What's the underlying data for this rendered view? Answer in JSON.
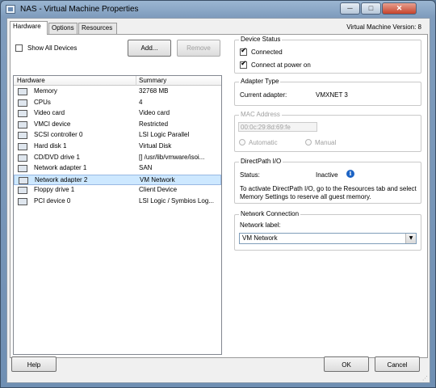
{
  "window": {
    "title": "NAS - Virtual Machine Properties",
    "minimize_glyph": "─",
    "maximize_glyph": "□",
    "close_glyph": "✕"
  },
  "tabs": [
    {
      "label": "Hardware",
      "active": true
    },
    {
      "label": "Options",
      "active": false
    },
    {
      "label": "Resources",
      "active": false
    }
  ],
  "vm_version": "Virtual Machine Version: 8",
  "hardware_toolbar": {
    "show_all_devices_label": "Show All Devices",
    "show_all_devices_checked": false,
    "add_label": "Add...",
    "remove_label": "Remove"
  },
  "hardware_table": {
    "columns": [
      "Hardware",
      "Summary"
    ],
    "rows": [
      {
        "name": "Memory",
        "summary": "32768 MB",
        "icon": "memory-icon"
      },
      {
        "name": "CPUs",
        "summary": "4",
        "icon": "cpu-icon"
      },
      {
        "name": "Video card",
        "summary": "Video card",
        "icon": "video-card-icon"
      },
      {
        "name": "VMCI device",
        "summary": "Restricted",
        "icon": "vmci-device-icon"
      },
      {
        "name": "SCSI controller 0",
        "summary": "LSI Logic Parallel",
        "icon": "scsi-controller-icon"
      },
      {
        "name": "Hard disk 1",
        "summary": "Virtual Disk",
        "icon": "hard-disk-icon"
      },
      {
        "name": "CD/DVD drive 1",
        "summary": "[] /usr/lib/vmware/isoi...",
        "icon": "cd-dvd-icon"
      },
      {
        "name": "Network adapter 1",
        "summary": "SAN",
        "icon": "network-adapter-icon"
      },
      {
        "name": "Network adapter 2",
        "summary": "VM Network",
        "icon": "network-adapter-icon",
        "selected": true
      },
      {
        "name": "Floppy drive 1",
        "summary": "Client Device",
        "icon": "floppy-icon"
      },
      {
        "name": "PCI device 0",
        "summary": "LSI Logic / Symbios Log...",
        "icon": "pci-device-icon"
      }
    ]
  },
  "device_status": {
    "title": "Device Status",
    "connected_label": "Connected",
    "connected_checked": true,
    "connect_power_on_label": "Connect at power on",
    "connect_power_on_checked": true
  },
  "adapter_type": {
    "title": "Adapter Type",
    "current_label": "Current adapter:",
    "current_value": "VMXNET 3"
  },
  "mac_address": {
    "title": "MAC Address",
    "value": "00:0c:29:8d:69:fe",
    "automatic_label": "Automatic",
    "manual_label": "Manual"
  },
  "directpath": {
    "title": "DirectPath I/O",
    "status_label": "Status:",
    "status_value": "Inactive",
    "info_glyph": "i",
    "note": "To activate DirectPath I/O, go to the Resources tab and select Memory Settings to reserve all guest memory."
  },
  "network_connection": {
    "title": "Network Connection",
    "label": "Network label:",
    "selected": "VM Network",
    "arrow_glyph": "▼"
  },
  "footer": {
    "help_label": "Help",
    "ok_label": "OK",
    "cancel_label": "Cancel",
    "grip_glyph": "⋰"
  }
}
